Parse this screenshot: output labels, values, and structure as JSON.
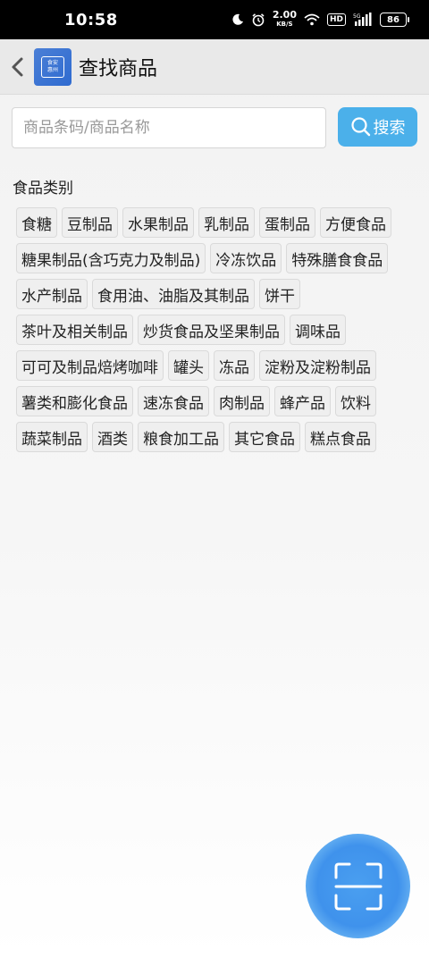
{
  "status_bar": {
    "time": "10:58",
    "net_speed": "2.00",
    "net_unit": "KB/S",
    "hd": "HD",
    "signal_label": "5G",
    "battery": "86"
  },
  "header": {
    "title": "查找商品",
    "logo_line1": "食安",
    "logo_line2": "惠州"
  },
  "search": {
    "placeholder": "商品条码/商品名称",
    "value": "",
    "button_label": "搜索"
  },
  "category": {
    "title": "食品类别",
    "rows": [
      [
        "食糖",
        "豆制品",
        "水果制品",
        "乳制品",
        "蛋制品",
        "方便食品"
      ],
      [
        "糖果制品(含巧克力及制品)",
        "冷冻饮品",
        "特殊膳食食品"
      ],
      [
        "水产制品",
        "食用油、油脂及其制品",
        "饼干"
      ],
      [
        "茶叶及相关制品",
        "炒货食品及坚果制品",
        "调味品"
      ],
      [
        "可可及制品焙烤咖啡",
        "罐头",
        "冻品",
        "淀粉及淀粉制品"
      ],
      [
        "薯类和膨化食品",
        "速冻食品",
        "肉制品",
        "蜂产品",
        "饮料"
      ],
      [
        "蔬菜制品",
        "酒类",
        "粮食加工品",
        "其它食品",
        "糕点食品"
      ]
    ]
  },
  "colors": {
    "accent": "#4bb0ea",
    "fab": "#3f92ec",
    "header_bg": "#e9e9e9"
  },
  "icons": {
    "back": "chevron-left-icon",
    "search": "magnifier-icon",
    "scan": "scan-frame-icon"
  }
}
